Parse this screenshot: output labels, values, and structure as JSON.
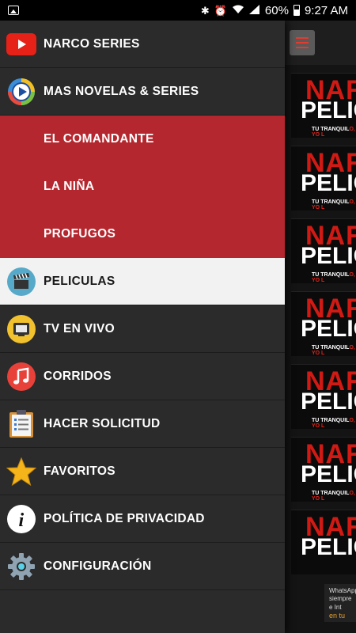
{
  "status_bar": {
    "battery_percent": "60%",
    "time": "9:27 AM"
  },
  "menu": [
    {
      "label": "NARCO SERIES",
      "icon": "youtube-icon"
    },
    {
      "label": "MAS NOVELAS & SERIES",
      "icon": "media-player-icon"
    },
    {
      "label": "EL COMANDANTE",
      "icon": null
    },
    {
      "label": "LA NIÑA",
      "icon": null
    },
    {
      "label": "PROFUGOS",
      "icon": null
    },
    {
      "label": "PELICULAS",
      "icon": "clapperboard-icon"
    },
    {
      "label": "TV EN VIVO",
      "icon": "tv-icon"
    },
    {
      "label": "CORRIDOS",
      "icon": "music-note-icon"
    },
    {
      "label": "HACER SOLICITUD",
      "icon": "clipboard-icon"
    },
    {
      "label": "FAVORITOS",
      "icon": "star-icon"
    },
    {
      "label": "POLÍTICA DE PRIVACIDAD",
      "icon": "info-icon"
    },
    {
      "label": "CONFIGURACIÓN",
      "icon": "gear-icon"
    }
  ],
  "thumbnail": {
    "title_top": "NAR",
    "title_bottom": "PELICU",
    "tagline_white": "TU TRANQUIL",
    "tagline_red": "O, YO L"
  },
  "promo": {
    "line1": "WhatsApp",
    "line2": "siempre e Int",
    "line3": "en tu pla"
  },
  "colors": {
    "drawer_bg": "#2b2b2b",
    "submenu_bg": "#b5272e",
    "active_bg": "#f2f2f2",
    "accent_red": "#d21a14"
  }
}
